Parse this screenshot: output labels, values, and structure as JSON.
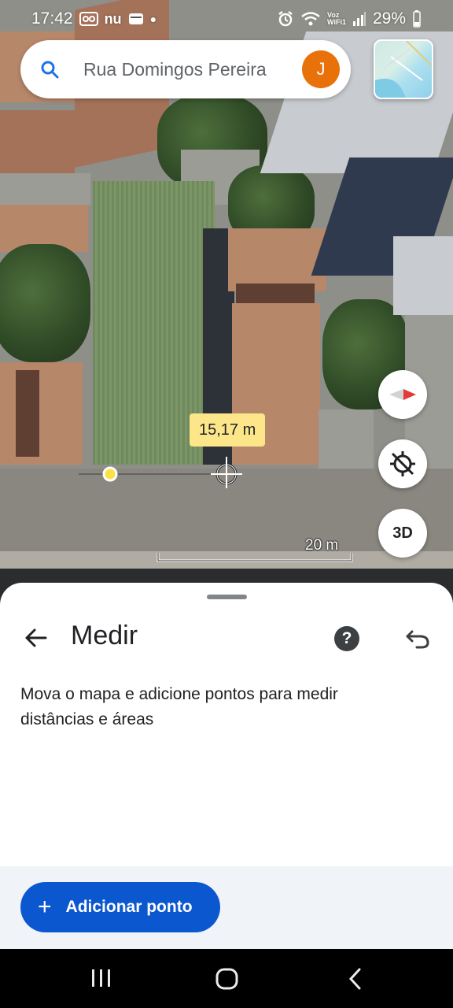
{
  "status_bar": {
    "time": "17:42",
    "app_indicators": "nu",
    "network_label_top": "Voz",
    "network_label_bottom": "WiFi1",
    "battery": "29%"
  },
  "search": {
    "query": "Rua Domingos Pereira",
    "avatar_letter": "J",
    "avatar_color": "#e8710a"
  },
  "map": {
    "distance_label": "15,17 m",
    "scale_label": "20 m",
    "btn_3d_label": "3D",
    "compass_icon": "compass-icon",
    "location_icon": "location-off-icon"
  },
  "sheet": {
    "title": "Medir",
    "help_label": "?",
    "description": "Mova o mapa e adicione pontos para medir distâncias e áreas",
    "add_point_plus": "+",
    "add_point_label": "Adicionar ponto",
    "accent_color": "#0b57d0"
  }
}
